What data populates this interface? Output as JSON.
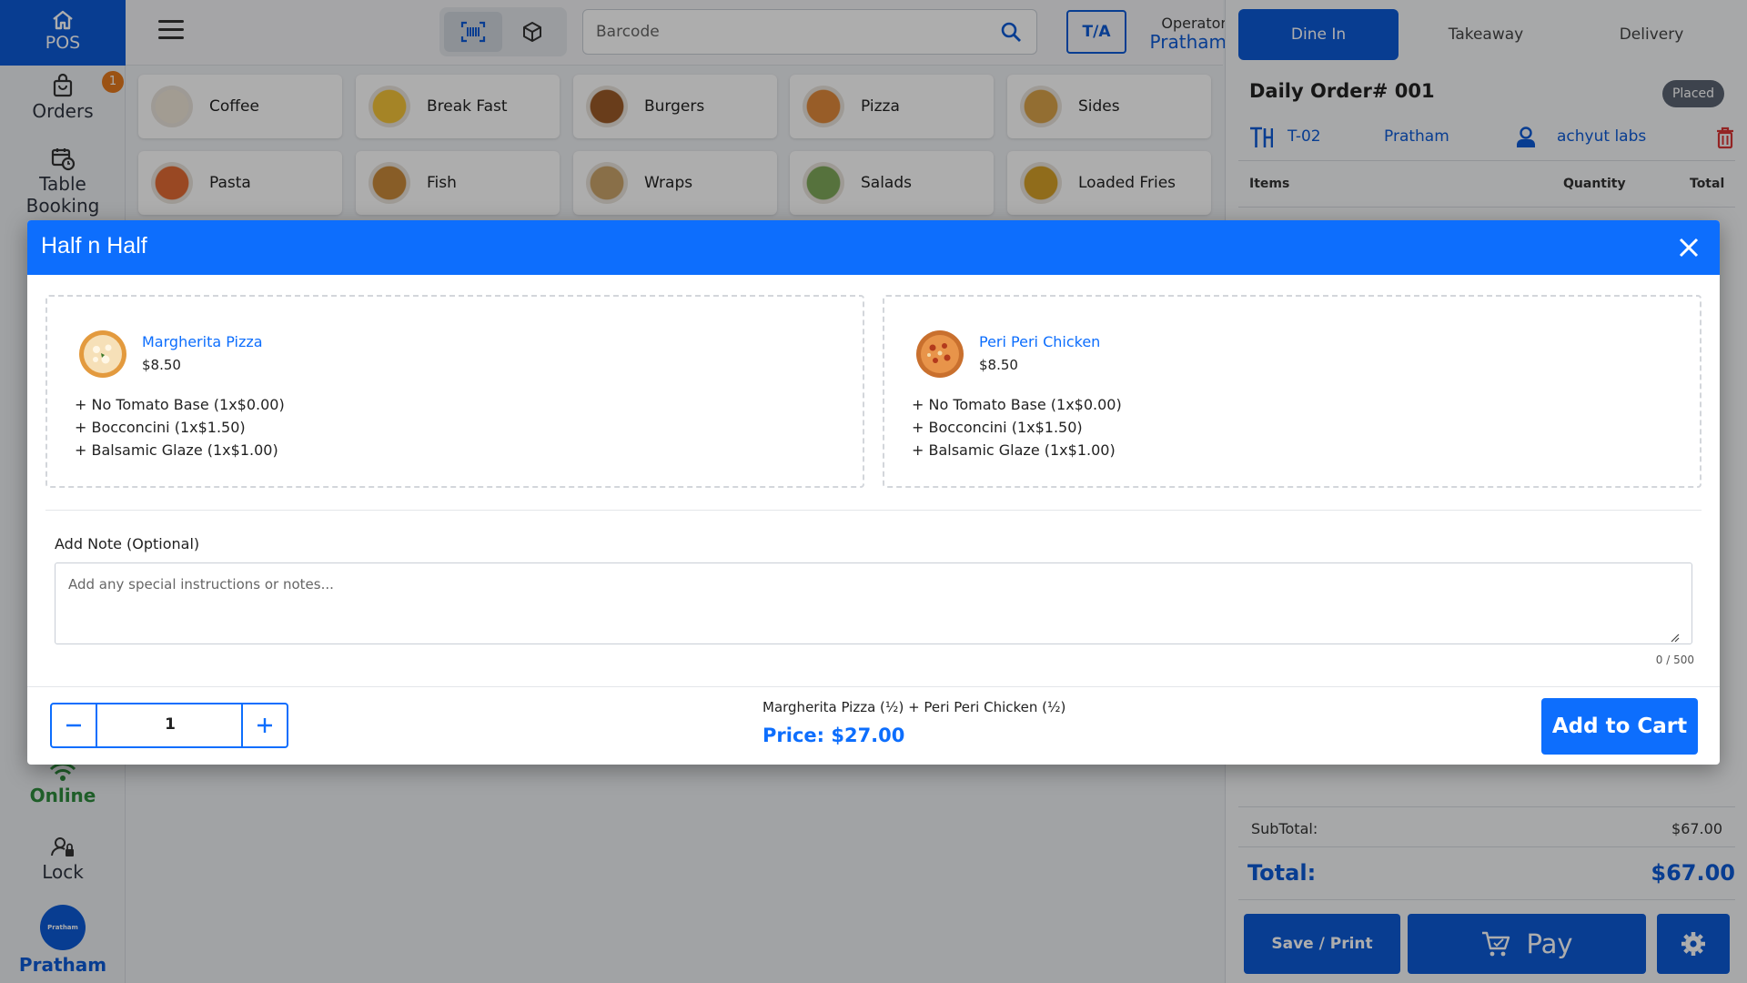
{
  "rail": {
    "pos_label": "POS",
    "orders_label": "Orders",
    "orders_badge": "1",
    "table_label_1": "Table",
    "table_label_2": "Booking",
    "online_label": "Online",
    "lock_label": "Lock",
    "user_label": "Pratham",
    "avatar_text": "Pratham"
  },
  "topbar": {
    "search_placeholder": "Barcode",
    "ta_label": "T/A",
    "operator_label": "Operator",
    "operator_name": "Pratham"
  },
  "categories": [
    {
      "label": "Coffee",
      "color": "#efe6d8"
    },
    {
      "label": "Break Fast",
      "color": "#f3c338"
    },
    {
      "label": "Burgers",
      "color": "#9b5a28"
    },
    {
      "label": "Pizza",
      "color": "#e08a3c"
    },
    {
      "label": "Sides",
      "color": "#d9a24a"
    },
    {
      "label": "Pasta",
      "color": "#e26a34"
    },
    {
      "label": "Fish",
      "color": "#c98a3a"
    },
    {
      "label": "Wraps",
      "color": "#caa46a"
    },
    {
      "label": "Salads",
      "color": "#7fa95a"
    },
    {
      "label": "Loaded Fries",
      "color": "#d4a028"
    }
  ],
  "order": {
    "tabs": [
      "Dine In",
      "Takeaway",
      "Delivery"
    ],
    "title": "Daily Order# 001",
    "status": "Placed",
    "table": "T-02",
    "operator": "Pratham",
    "customer": "achyut labs",
    "col_items": "Items",
    "col_quantity": "Quantity",
    "col_total": "Total",
    "subtotal_label": "SubTotal:",
    "subtotal_value": "$67.00",
    "total_label": "Total:",
    "total_value": "$67.00",
    "save_print_label": "Save / Print",
    "pay_label": "Pay"
  },
  "modal": {
    "title": "Half n Half",
    "left": {
      "name": "Margherita Pizza",
      "price": "$8.50",
      "modifiers": [
        "+ No Tomato Base (1x$0.00)",
        "+ Bocconcini (1x$1.50)",
        "+ Balsamic Glaze (1x$1.00)"
      ]
    },
    "right": {
      "name": "Peri Peri Chicken",
      "price": "$8.50",
      "modifiers": [
        "+ No Tomato Base (1x$0.00)",
        "+ Bocconcini (1x$1.50)",
        "+ Balsamic Glaze (1x$1.00)"
      ]
    },
    "note_label": "Add Note (Optional)",
    "note_placeholder": "Add any special instructions or notes...",
    "note_counter": "0 / 500",
    "quantity": "1",
    "summary": "Margherita Pizza (½) + Peri Peri Chicken (½)",
    "price": "Price: $27.00",
    "add_to_cart_label": "Add to Cart"
  },
  "colors": {
    "brand": "#0d5ad6",
    "modal_accent": "#0d6efd",
    "online": "#2e8b3d",
    "badge": "#e57a1e"
  },
  "icons": [
    "home-icon",
    "bag-icon",
    "calendar-clock-icon",
    "wifi-icon",
    "user-lock-icon",
    "hamburger-icon",
    "barcode-icon",
    "cube-icon",
    "search-icon",
    "table-icon",
    "person-icon",
    "trash-icon",
    "close-icon",
    "minus-icon",
    "plus-icon",
    "cart-icon",
    "gear-icon"
  ]
}
